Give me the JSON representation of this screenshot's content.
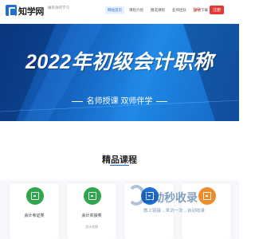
{
  "header": {
    "brand": "知学网",
    "slogan": "做有效的学习",
    "nav": [
      {
        "label": "网站首页",
        "active": true
      },
      {
        "label": "课程介绍",
        "active": false
      },
      {
        "label": "精选课程",
        "active": false
      },
      {
        "label": "名师团队",
        "active": false
      },
      {
        "label": "APP下载",
        "active": false
      }
    ],
    "login_label": "登陆",
    "register_label": "注册"
  },
  "banner": {
    "title": "2022年初级会计职称",
    "subtitle": "名师授课  双师伴学",
    "slides": 3,
    "active_slide": 1
  },
  "courses": {
    "title": "精品课程",
    "cards": [
      {
        "label": "会计考证类",
        "note": "",
        "icon": "image-icon",
        "color": "#2ca84a"
      },
      {
        "label": "会计实操类",
        "note": "会计实操",
        "icon": "calculator-icon",
        "color": "#2ca84a"
      },
      {
        "label": "",
        "note": "",
        "icon": "book-icon",
        "color": "#1e6fd9"
      },
      {
        "label": "",
        "note": "",
        "icon": "tools-icon",
        "color": "#f08b2a"
      }
    ]
  },
  "watermark": {
    "title": "自动秒收录",
    "subtitle": "做上链接→来访一次→自动收录"
  },
  "colors": {
    "accent": "#1e6fd9",
    "banner": "#1565c0",
    "register": "#e53935"
  }
}
